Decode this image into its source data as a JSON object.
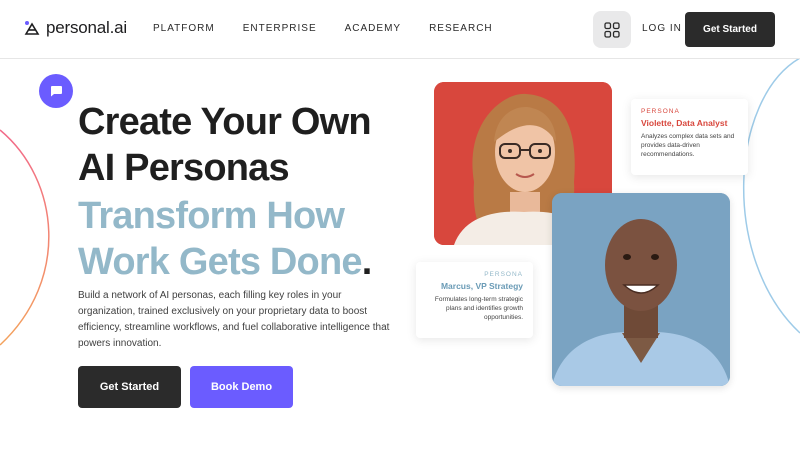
{
  "header": {
    "brand": "personal.ai",
    "nav": [
      "PLATFORM",
      "ENTERPRISE",
      "ACADEMY",
      "RESEARCH"
    ],
    "login_label": "LOG IN",
    "cta_label": "Get Started"
  },
  "hero": {
    "headline_line1": "Create Your Own",
    "headline_line2": "AI Personas",
    "subheadline_line1": "Transform How",
    "subheadline_line2": "Work Gets Done",
    "subheadline_dot": ".",
    "description": "Build a network of AI personas, each filling key roles in your organization, trained exclusively on your proprietary data to boost efficiency, streamline workflows, and fuel collaborative intelligence that powers innovation.",
    "primary_button": "Get Started",
    "secondary_button": "Book Demo"
  },
  "personas": [
    {
      "kicker": "PERSONA",
      "name": "Violette, Data Analyst",
      "description": "Analyzes complex data sets and provides data-driven recommendations.",
      "accent": "#d8473d"
    },
    {
      "kicker": "PERSONA",
      "name": "Marcus, VP Strategy",
      "description": "Formulates long-term strategic plans and identifies growth opportunities.",
      "accent": "#93b8c9"
    }
  ],
  "colors": {
    "brand_purple": "#6b5cff",
    "dark": "#2b2b2b",
    "headline_blue": "#93b8c9"
  },
  "icons": {
    "chat": "chat-bubble-icon",
    "apps": "app-grid-icon",
    "logo": "personal-ai-logo-icon"
  }
}
